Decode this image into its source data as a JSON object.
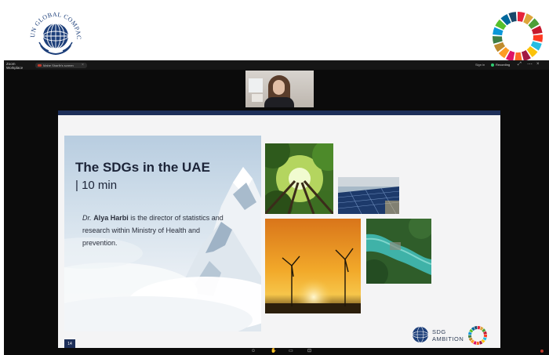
{
  "header": {
    "ungc_logo_text": "UN GLOBAL COMPACT"
  },
  "meeting": {
    "workspace_label_line1": "Zoom",
    "workspace_label_line2": "Workplace",
    "share_tab": "Mahe Sharfir's screen",
    "recording_label": "Recording",
    "sign_in": "Sign in"
  },
  "slide": {
    "title": "The SDGs in the UAE",
    "duration": "| 10 min",
    "bio_prefix": "Dr.",
    "bio_name": "Alya Harbi",
    "bio_rest": " is the director of statistics and research within Ministry of Health and prevention.",
    "sdg_logo_line1": "SDG",
    "sdg_logo_line2": "AMBITION",
    "page_number": "14"
  },
  "colors": {
    "navy": "#1d2f5a",
    "sdg_wheel": [
      "#e5243b",
      "#dda63a",
      "#4c9f38",
      "#c5192d",
      "#ff3a21",
      "#26bde2",
      "#fcc30b",
      "#a21942",
      "#fd6925",
      "#dd1367",
      "#fd9d24",
      "#bf8b2e",
      "#3f7e44",
      "#0a97d9",
      "#56c02b",
      "#00689d",
      "#19486a"
    ]
  }
}
